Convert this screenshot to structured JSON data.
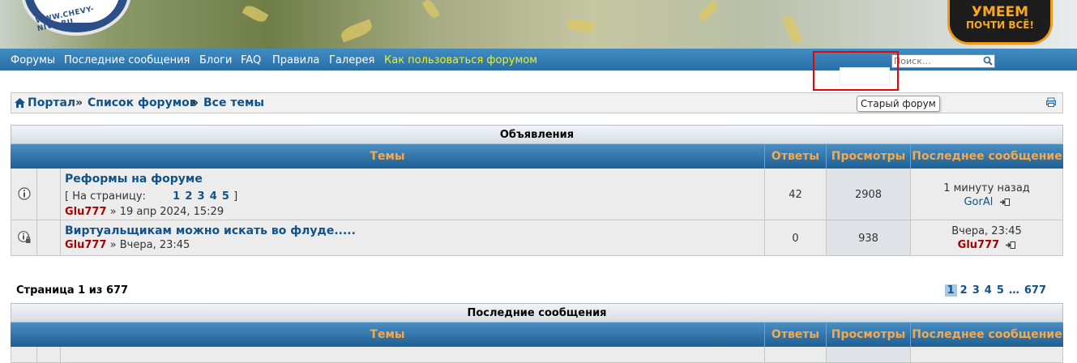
{
  "banner": {
    "logo_url_text": "WWW.CHEVY-NIVA.RU",
    "badge_line1": "УМЕЕМ",
    "badge_line2": "ПОЧТИ ВСЁ!"
  },
  "nav": {
    "items": [
      "Форумы",
      "Последние сообщения",
      "Блоги",
      "FAQ",
      "Правила",
      "Галерея"
    ],
    "highlight": "Как пользоваться форумом"
  },
  "search": {
    "placeholder": "Поиск…"
  },
  "tooltip": "Старый форум",
  "breadcrumb": {
    "portal": "Портал",
    "forums": "Список форумов",
    "all_topics": "Все темы",
    "sep": "»"
  },
  "announcements": {
    "title": "Объявления",
    "columns": {
      "topics": "Темы",
      "replies": "Ответы",
      "views": "Просмотры",
      "last_post": "Последнее сообщение"
    },
    "rows": [
      {
        "title": "Реформы на форуме",
        "pages_label": "[ На страницу:",
        "pages": [
          "1",
          "2",
          "3",
          "4",
          "5"
        ],
        "pages_close": "]",
        "author": "Glu777",
        "date": "» 19 апр 2024, 15:29",
        "replies": "42",
        "views": "2908",
        "last_time": "1 минуту назад",
        "last_user": "GorAl"
      },
      {
        "title": "Виртуальщикам можно искать во флуде.....",
        "author": "Glu777",
        "date": "» Вчера, 23:45",
        "replies": "0",
        "views": "938",
        "last_time": "Вчера, 23:45",
        "last_user": "Glu777"
      }
    ]
  },
  "pagination": {
    "info": "Страница 1 из 677",
    "current": "1",
    "pages": [
      "2",
      "3",
      "4",
      "5"
    ],
    "ellipsis": "…",
    "last": "677"
  },
  "recent": {
    "title": "Последние сообщения",
    "columns": {
      "topics": "Темы",
      "replies": "Ответы",
      "views": "Просмотры",
      "last_post": "Последнее сообщение"
    }
  }
}
